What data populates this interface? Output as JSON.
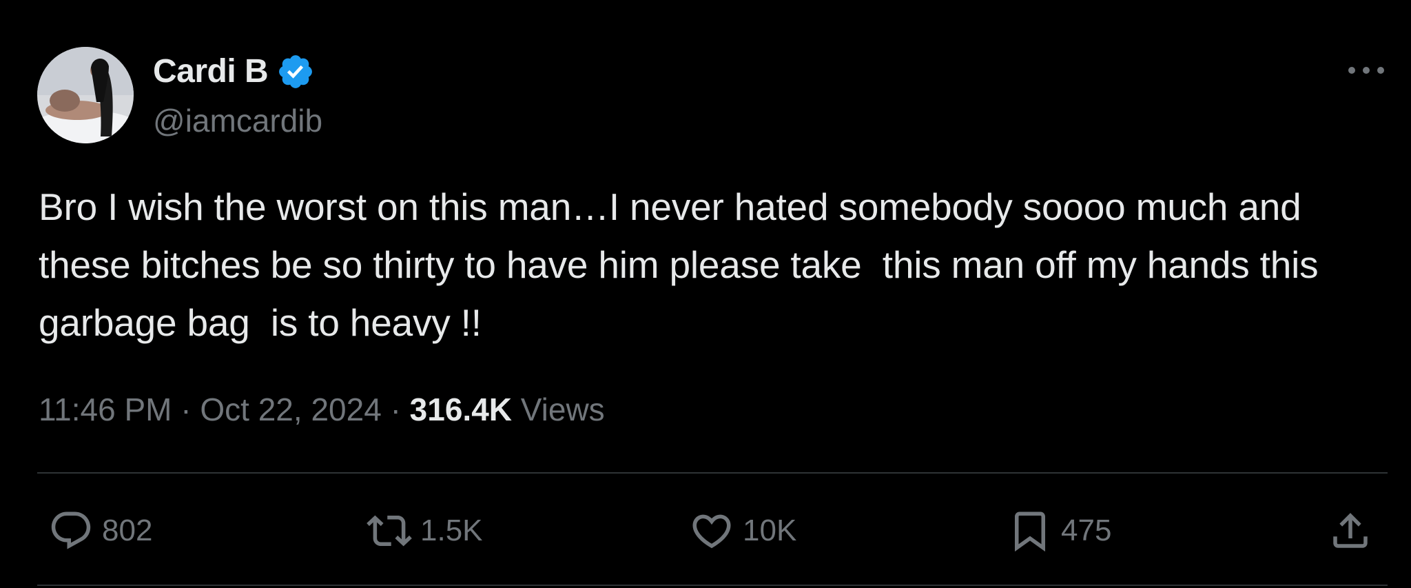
{
  "author": {
    "name": "Cardi B",
    "handle": "@iamcardib",
    "verified": true
  },
  "tweet": {
    "text": "Bro I wish the worst on this man…I never hated somebody soooo much and these bitches be so thirty to have him please take  this man off my hands this garbage bag  is to heavy !!",
    "time": "11:46 PM",
    "separator": "·",
    "date": "Oct 22, 2024",
    "views_count": "316.4K",
    "views_label": "Views"
  },
  "actions": {
    "replies": "802",
    "reposts": "1.5K",
    "likes": "10K",
    "bookmarks": "475"
  },
  "icons": {
    "verified": "verified-badge-icon",
    "more": "more-options-icon",
    "reply": "reply-icon",
    "repost": "repost-icon",
    "like": "heart-icon",
    "bookmark": "bookmark-icon",
    "share": "share-icon"
  },
  "colors": {
    "background": "#000000",
    "primary_text": "#e7e9ea",
    "secondary_text": "#71767b",
    "verified_blue": "#1d9bf0",
    "divider": "#2f3336"
  }
}
